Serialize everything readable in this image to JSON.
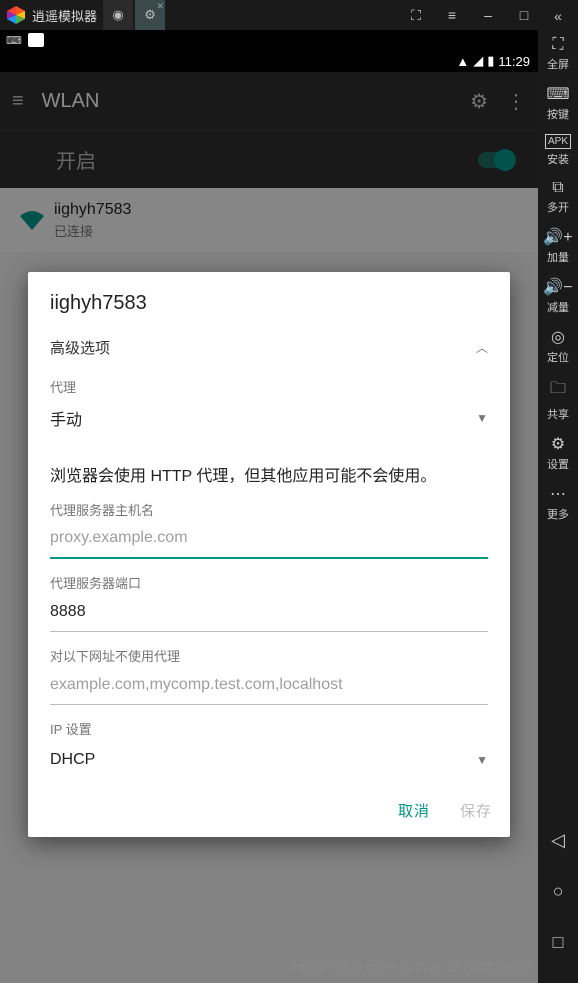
{
  "window": {
    "title": "逍遥模拟器",
    "buttons": {
      "full": "⛶",
      "menu": "≡",
      "min": "–",
      "restore": "□",
      "close": "✕"
    }
  },
  "rightbar": {
    "collapse": "«",
    "tools": [
      {
        "icon": "⛶",
        "label": "全屏"
      },
      {
        "icon": "⌨",
        "label": "按键"
      },
      {
        "icon": "APK",
        "label": "安装"
      },
      {
        "icon": "⧉",
        "label": "多开"
      },
      {
        "icon": "🔊+",
        "label": "加量"
      },
      {
        "icon": "🔊−",
        "label": "减量"
      },
      {
        "icon": "◎",
        "label": "定位"
      },
      {
        "icon": "🗀",
        "label": "共享"
      },
      {
        "icon": "⚙",
        "label": "设置"
      },
      {
        "icon": "⋯",
        "label": "更多"
      }
    ],
    "nav": {
      "back": "◁",
      "home": "○",
      "recent": "□"
    }
  },
  "statusbar": {
    "wifi": "▲",
    "signal": "◢",
    "battery": "▮",
    "time": "11:29"
  },
  "wlan": {
    "screen_title": "WLAN",
    "toggle_label": "开启",
    "network": {
      "name": "iighyh7583",
      "status": "已连接"
    }
  },
  "dialog": {
    "title": "iighyh7583",
    "advanced_label": "高级选项",
    "proxy_label": "代理",
    "proxy_value": "手动",
    "proxy_hint": "浏览器会使用 HTTP 代理，但其他应用可能不会使用。",
    "hostname_label": "代理服务器主机名",
    "hostname_placeholder": "proxy.example.com",
    "hostname_value": "",
    "port_label": "代理服务器端口",
    "port_value": "8888",
    "bypass_label": "对以下网址不使用代理",
    "bypass_placeholder": "example.com,mycomp.test.com,localhost",
    "bypass_value": "",
    "ip_label": "IP 设置",
    "ip_value": "DHCP",
    "cancel": "取消",
    "save": "保存"
  },
  "watermark": "https://blog.csdn.net/weixin_44836662"
}
